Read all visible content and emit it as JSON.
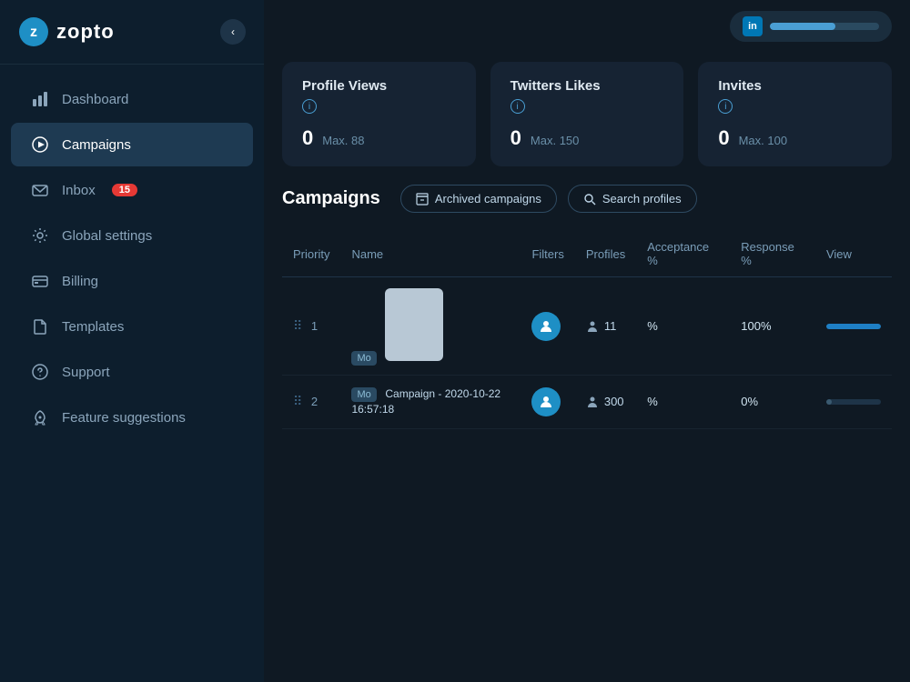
{
  "sidebar": {
    "logo": "zopto",
    "collapse_icon": "‹",
    "nav_items": [
      {
        "id": "dashboard",
        "label": "Dashboard",
        "icon": "bar-chart",
        "active": false,
        "badge": null
      },
      {
        "id": "campaigns",
        "label": "Campaigns",
        "icon": "play-circle",
        "active": true,
        "badge": null
      },
      {
        "id": "inbox",
        "label": "Inbox",
        "icon": "envelope",
        "active": false,
        "badge": "15"
      },
      {
        "id": "global-settings",
        "label": "Global settings",
        "icon": "gear",
        "active": false,
        "badge": null
      },
      {
        "id": "billing",
        "label": "Billing",
        "icon": "credit-card",
        "active": false,
        "badge": null
      },
      {
        "id": "templates",
        "label": "Templates",
        "icon": "file",
        "active": false,
        "badge": null
      },
      {
        "id": "support",
        "label": "Support",
        "icon": "question-circle",
        "active": false,
        "badge": null
      },
      {
        "id": "feature-suggestions",
        "label": "Feature suggestions",
        "icon": "rocket",
        "active": false,
        "badge": null
      }
    ]
  },
  "topbar": {
    "linkedin_label": "in"
  },
  "stats": {
    "cards": [
      {
        "id": "profile-views",
        "title": "Profile Views",
        "current": "0",
        "max": "Max. 88"
      },
      {
        "id": "twitter-likes",
        "title": "Twitters Likes",
        "current": "0",
        "max": "Max. 150"
      },
      {
        "id": "invites",
        "title": "Invites",
        "current": "0",
        "max": "Max. 100"
      }
    ]
  },
  "campaigns": {
    "title": "Campaigns",
    "buttons": [
      {
        "id": "archived",
        "label": "Archived campaigns",
        "icon": "archive"
      },
      {
        "id": "search",
        "label": "Search profiles",
        "icon": "search"
      }
    ],
    "table": {
      "headers": [
        "Priority",
        "Name",
        "Filters",
        "Profiles",
        "Acceptance %",
        "Response %",
        "View"
      ],
      "rows": [
        {
          "priority": "1",
          "name": "",
          "has_thumb": true,
          "filters_avatar": true,
          "profiles": "11",
          "acceptance": "%",
          "response": "100%",
          "progress_type": "blue",
          "progress_pct": 100
        },
        {
          "priority": "2",
          "name": "Campaign - 2020-10-22 16:57:18",
          "has_thumb": false,
          "filters_avatar": true,
          "profiles": "300",
          "acceptance": "%",
          "response": "0%",
          "progress_type": "gray",
          "progress_pct": 10
        }
      ]
    }
  }
}
